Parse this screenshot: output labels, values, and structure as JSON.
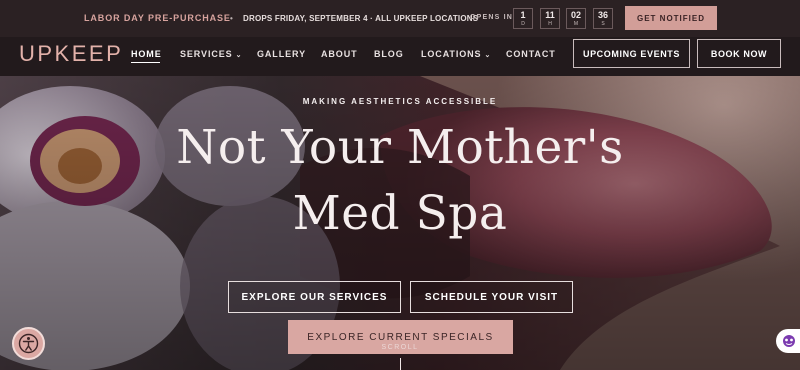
{
  "topbar": {
    "promo": "LABOR DAY PRE-PURCHASE",
    "separator": "•",
    "drop_text": "DROPS FRIDAY, SEPTEMBER 4 · ALL UPKEEP LOCATIONS",
    "opens_in": "OPENS IN",
    "countdown": [
      {
        "value": "1",
        "unit": "D"
      },
      {
        "value": "11",
        "unit": "H"
      },
      {
        "value": "02",
        "unit": "M"
      },
      {
        "value": "36",
        "unit": "S"
      }
    ],
    "notify_label": "GET NOTIFIED"
  },
  "nav": {
    "logo": "UPKEEP",
    "items": [
      {
        "label": "HOME"
      },
      {
        "label": "SERVICES"
      },
      {
        "label": "GALLERY"
      },
      {
        "label": "ABOUT"
      },
      {
        "label": "BLOG"
      },
      {
        "label": "LOCATIONS"
      },
      {
        "label": "CONTACT"
      }
    ],
    "events_label": "UPCOMING EVENTS",
    "book_label": "BOOK NOW"
  },
  "hero": {
    "eyebrow": "MAKING AESTHETICS ACCESSIBLE",
    "title_line1": "Not Your Mother's",
    "title_line2": "Med Spa",
    "cta_services": "EXPLORE OUR SERVICES",
    "cta_schedule": "SCHEDULE YOUR VISIT",
    "cta_specials": "EXPLORE CURRENT SPECIALS",
    "scroll": "SCROLL"
  },
  "colors": {
    "accent": "#d29e98",
    "dark": "#221a1c"
  },
  "icons": {
    "accessibility": "accessibility-icon",
    "chat": "chat-icon",
    "chevron": "chevron-down-icon"
  }
}
